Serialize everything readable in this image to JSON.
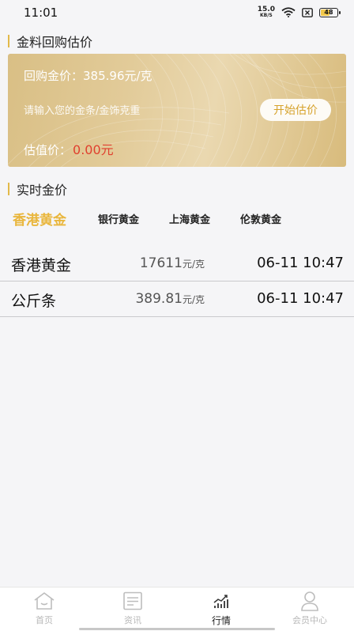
{
  "status_bar": {
    "time": "11:01",
    "net_speed_value": "15.0",
    "net_speed_unit": "KB/S",
    "battery_level": "48"
  },
  "estimate_section": {
    "title": "金料回购估价",
    "buyback_label": "回购金价：",
    "buyback_price": "385.96元/克",
    "input_placeholder": "请输入您的金条/金饰克重",
    "start_button": "开始估价",
    "valuation_label": "估值价：",
    "valuation_value": "0.00元"
  },
  "realtime_section": {
    "title": "实时金价",
    "tabs": [
      {
        "label": "香港黄金",
        "active": true
      },
      {
        "label": "银行黄金",
        "active": false
      },
      {
        "label": "上海黄金",
        "active": false
      },
      {
        "label": "伦敦黄金",
        "active": false
      }
    ]
  },
  "price_list": [
    {
      "name": "香港黄金",
      "price": "17611",
      "unit": "元/克",
      "time": "06-11 10:47"
    },
    {
      "name": "公斤条",
      "price": "389.81",
      "unit": "元/克",
      "time": "06-11 10:47"
    }
  ],
  "bottom_nav": [
    {
      "label": "首页",
      "icon": "home-icon",
      "active": false
    },
    {
      "label": "资讯",
      "icon": "news-icon",
      "active": false
    },
    {
      "label": "行情",
      "icon": "market-chart-icon",
      "active": true
    },
    {
      "label": "会员中心",
      "icon": "member-icon",
      "active": false
    }
  ],
  "colors": {
    "accent": "#e9b63c",
    "valuation": "#e0402e",
    "card_gold": "#e2cb99"
  }
}
